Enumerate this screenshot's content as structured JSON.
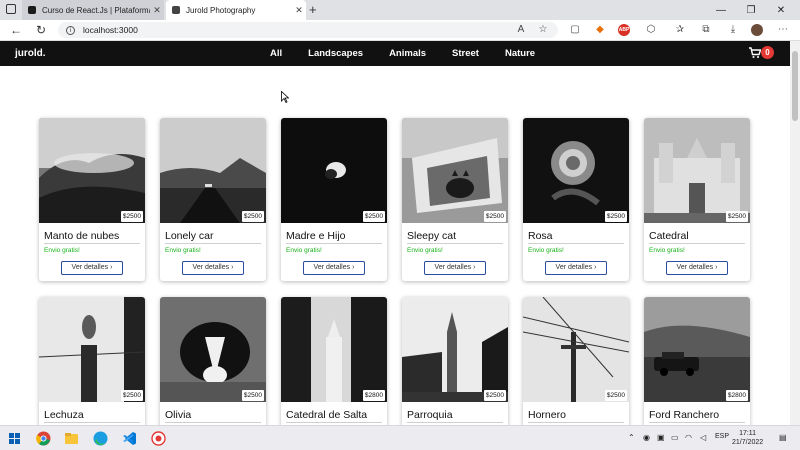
{
  "browser": {
    "tabs": [
      {
        "title": "Curso de React.Js | Plataforma e..."
      },
      {
        "title": "Jurold Photography"
      }
    ],
    "url": "localhost:3000"
  },
  "site": {
    "brand": "jurold.",
    "menu": [
      "All",
      "Landscapes",
      "Animals",
      "Street",
      "Nature"
    ],
    "cart_count": "0"
  },
  "products": [
    {
      "title": "Manto de nubes",
      "price": "$2500",
      "shipping": "Envio gratis!",
      "button": "Ver detalles"
    },
    {
      "title": "Lonely car",
      "price": "$2500",
      "shipping": "Envio gratis!",
      "button": "Ver detalles"
    },
    {
      "title": "Madre e Hijo",
      "price": "$2500",
      "shipping": "Envio gratis!",
      "button": "Ver detalles"
    },
    {
      "title": "Sleepy cat",
      "price": "$2500",
      "shipping": "Envio gratis!",
      "button": "Ver detalles"
    },
    {
      "title": "Rosa",
      "price": "$2500",
      "shipping": "Envio gratis!",
      "button": "Ver detalles"
    },
    {
      "title": "Catedral",
      "price": "$2500",
      "shipping": "Envio gratis!",
      "button": "Ver detalles"
    },
    {
      "title": "Lechuza",
      "price": "$2500",
      "shipping": "",
      "button": ""
    },
    {
      "title": "Olivia",
      "price": "$2500",
      "shipping": "",
      "button": ""
    },
    {
      "title": "Catedral de Salta",
      "price": "$2800",
      "shipping": "",
      "button": ""
    },
    {
      "title": "Parroquia",
      "price": "$2500",
      "shipping": "",
      "button": ""
    },
    {
      "title": "Hornero",
      "price": "$2500",
      "shipping": "",
      "button": ""
    },
    {
      "title": "Ford Ranchero",
      "price": "$2800",
      "shipping": "",
      "button": ""
    }
  ],
  "taskbar": {
    "lang": "ESP",
    "time": "17:11",
    "date": "21/7/2022"
  },
  "colors": {
    "navbar": "#111111",
    "accent_button_border": "#2c4ea0",
    "shipping_green": "#17b117",
    "cart_badge": "#e53935"
  }
}
